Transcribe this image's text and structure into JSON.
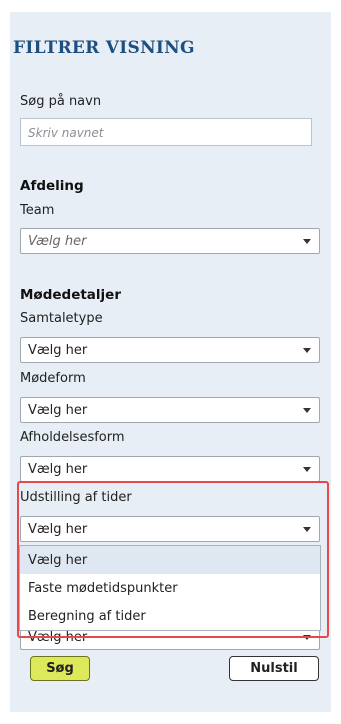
{
  "filter": {
    "title": "FILTRER VISNING",
    "name_label": "Søg på navn",
    "name_placeholder": "Skriv navnet"
  },
  "department": {
    "heading": "Afdeling",
    "team_label": "Team",
    "team_value": "Vælg her"
  },
  "meeting": {
    "heading": "Mødedetaljer",
    "conversation_type_label": "Samtaletype",
    "conversation_type_value": "Vælg her",
    "meeting_form_label": "Mødeform",
    "meeting_form_value": "Vælg her",
    "holding_form_label": "Afholdelsesform",
    "holding_form_value": "Vælg her",
    "time_display_label": "Udstilling af tider",
    "time_display_value": "Vælg her",
    "time_display_options": [
      "Vælg her",
      "Faste mødetidspunkter",
      "Beregning af tider"
    ],
    "hidden_select_value": "Vælg her"
  },
  "actions": {
    "search_label": "Søg",
    "reset_label": "Nulstil"
  },
  "colors": {
    "panel_bg": "#e8eef5",
    "title": "#1d4f7f",
    "highlight": "#e5484d",
    "search_button": "#dde85a"
  }
}
